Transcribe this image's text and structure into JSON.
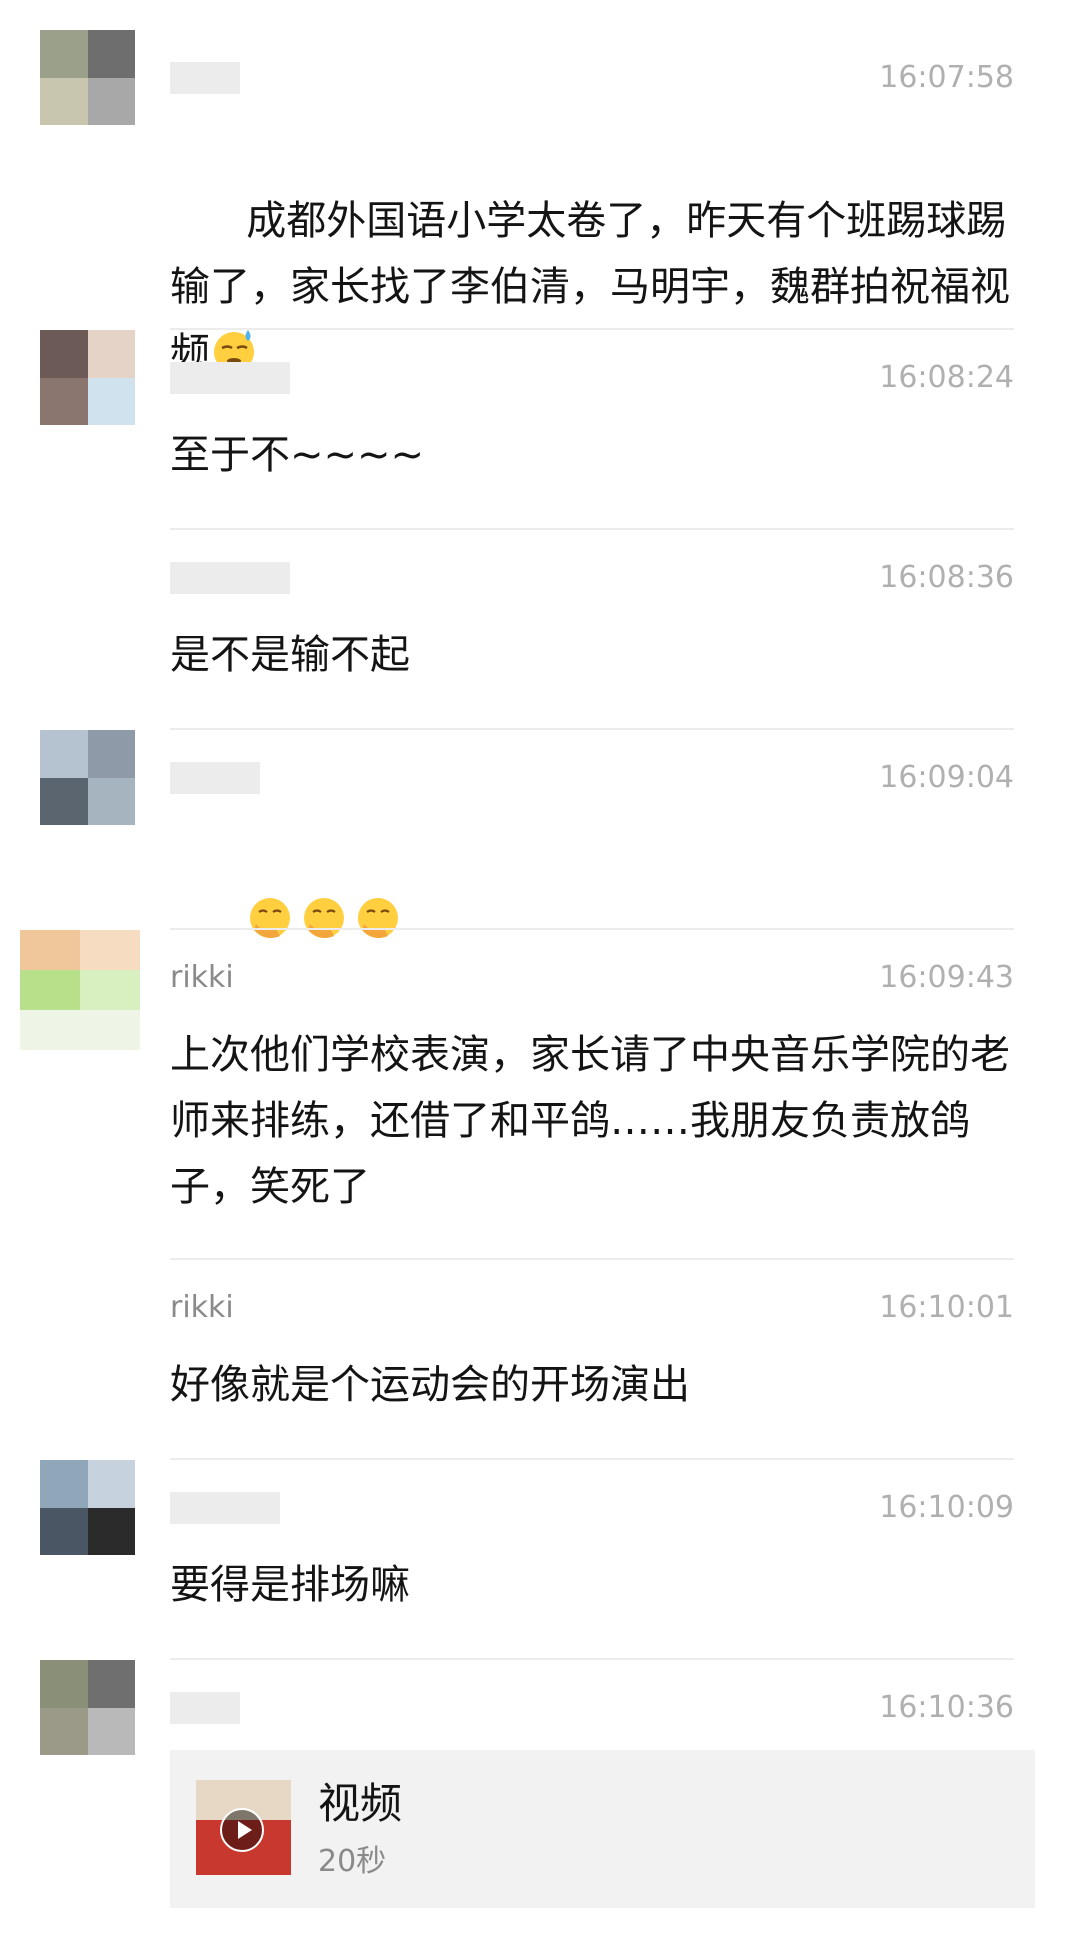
{
  "messages": [
    {
      "name": "",
      "time": "16:07:58",
      "text": "成都外国语小学太卷了，昨天有个班踢球踢输了，家长找了李伯清，马明宇，魏群拍祝福视频",
      "emoji": [
        "sweat-emoji"
      ]
    },
    {
      "name": "",
      "time": "16:08:24",
      "text": "至于不~~~~"
    },
    {
      "name": "",
      "time": "16:08:36",
      "text": "是不是输不起"
    },
    {
      "name": "",
      "time": "16:09:04",
      "text": "",
      "emoji": [
        "facepalm-emoji",
        "facepalm-emoji",
        "facepalm-emoji"
      ]
    },
    {
      "name": "rikki",
      "time": "16:09:43",
      "text": "上次他们学校表演，家长请了中央音乐学院的老师来排练，还借了和平鸽……我朋友负责放鸽子，笑死了"
    },
    {
      "name": "rikki",
      "time": "16:10:01",
      "text": "好像就是个运动会的开场演出"
    },
    {
      "name": "",
      "time": "16:10:09",
      "text": "要得是排场嘛"
    },
    {
      "name": "",
      "time": "16:10:36",
      "text": ""
    }
  ],
  "video_card": {
    "title": "视频",
    "duration": "20秒",
    "icon": "play-icon"
  },
  "colors": {
    "background": "#ffffff",
    "text": "#141414",
    "meta": "#b0b0b0",
    "divider": "#ececec",
    "card": "#f2f2f2"
  }
}
